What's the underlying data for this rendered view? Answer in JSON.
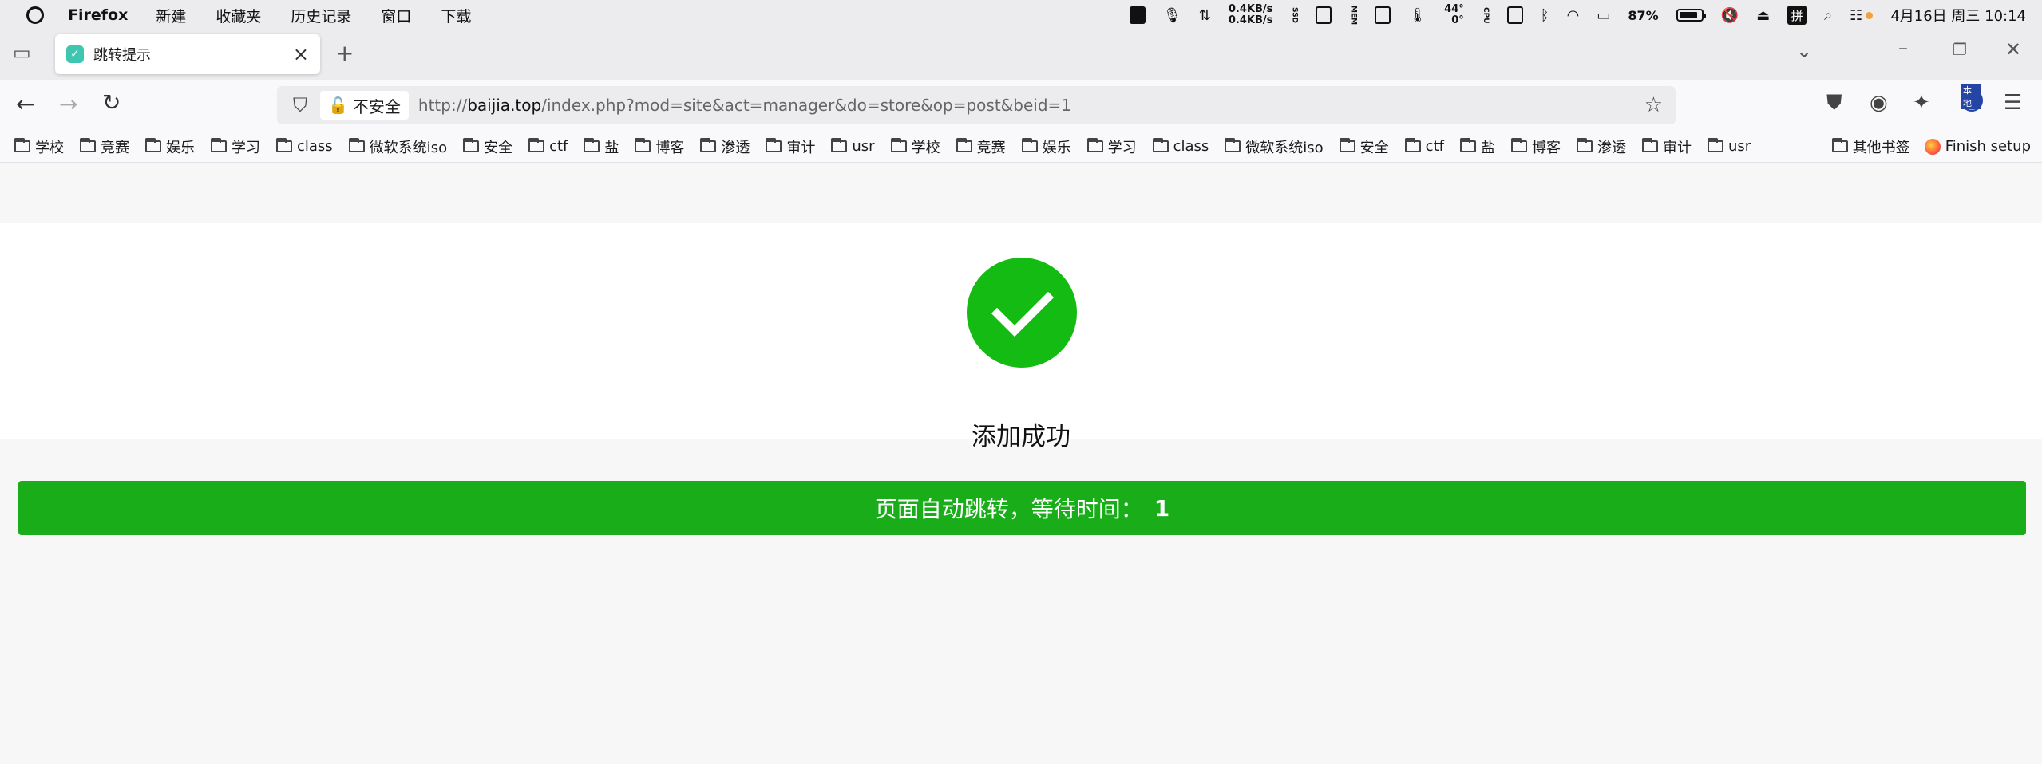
{
  "menubar": {
    "app_name": "Firefox",
    "items": [
      "新建",
      "收藏夹",
      "历史记录",
      "窗口",
      "下载"
    ],
    "net_up": "0.4KB/s",
    "net_down": "0.4KB/s",
    "ssd_label": "SSD",
    "mem_label": "MEM",
    "temp_top": "44°",
    "temp_bottom": "0°",
    "cpu_label": "CPU",
    "battery_percent": "87%",
    "input_method": "拼",
    "datetime": "4月16日 周三 10:14"
  },
  "tab": {
    "title": "跳转提示"
  },
  "navbar": {
    "security_label": "不安全",
    "url_prefix": "http://",
    "url_domain": "baijia.top",
    "url_path": "/index.php?mod=site&act=manager&do=store&op=post&beid=1",
    "avatar_label": "本地"
  },
  "bookmarks": {
    "items": [
      "学校",
      "竞赛",
      "娱乐",
      "学习",
      "class",
      "微软系统iso",
      "安全",
      "ctf",
      "盐",
      "博客",
      "渗透",
      "审计",
      "usr",
      "学校",
      "竞赛",
      "娱乐",
      "学习",
      "class",
      "微软系统iso",
      "安全",
      "ctf",
      "盐",
      "博客",
      "渗透",
      "审计",
      "usr"
    ],
    "other_label": "其他书签",
    "finish_setup": "Finish setup"
  },
  "page": {
    "success_message": "添加成功",
    "redirect_text": "页面自动跳转，等待时间：",
    "countdown": "1",
    "accent_color": "#19ad19"
  }
}
